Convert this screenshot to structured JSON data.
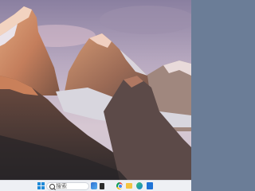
{
  "taskbar": {
    "search_placeholder": "搜索",
    "accent_color": "#1f8ad8",
    "icons": [
      "windows-start-icon",
      "search-icon",
      "widgets-icon",
      "task-view-icon",
      "chrome-icon",
      "file-explorer-icon",
      "edge-icon",
      "store-icon"
    ]
  },
  "wallpaper": {
    "subject": "mountain-peaks-at-sunset"
  }
}
